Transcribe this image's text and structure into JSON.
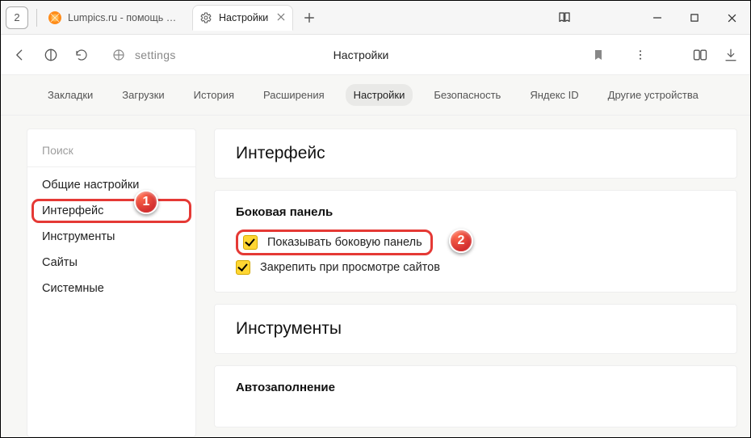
{
  "window": {
    "tab_count": "2"
  },
  "tabs": [
    {
      "label": "Lumpics.ru - помощь с ком"
    },
    {
      "label": "Настройки"
    }
  ],
  "address": {
    "text": "settings",
    "page_title": "Настройки"
  },
  "subnav": {
    "items": [
      "Закладки",
      "Загрузки",
      "История",
      "Расширения",
      "Настройки",
      "Безопасность",
      "Яндекс ID",
      "Другие устройства"
    ],
    "active_index": 4
  },
  "sidebar": {
    "search_placeholder": "Поиск",
    "items": [
      "Общие настройки",
      "Интерфейс",
      "Инструменты",
      "Сайты",
      "Системные"
    ],
    "active_index": 1
  },
  "main": {
    "section_title": "Интерфейс",
    "side_panel": {
      "heading": "Боковая панель",
      "opt1": "Показывать боковую панель",
      "opt2": "Закрепить при просмотре сайтов"
    },
    "tools_title": "Инструменты",
    "autofill_title": "Автозаполнение"
  },
  "badges": {
    "b1": "1",
    "b2": "2"
  }
}
